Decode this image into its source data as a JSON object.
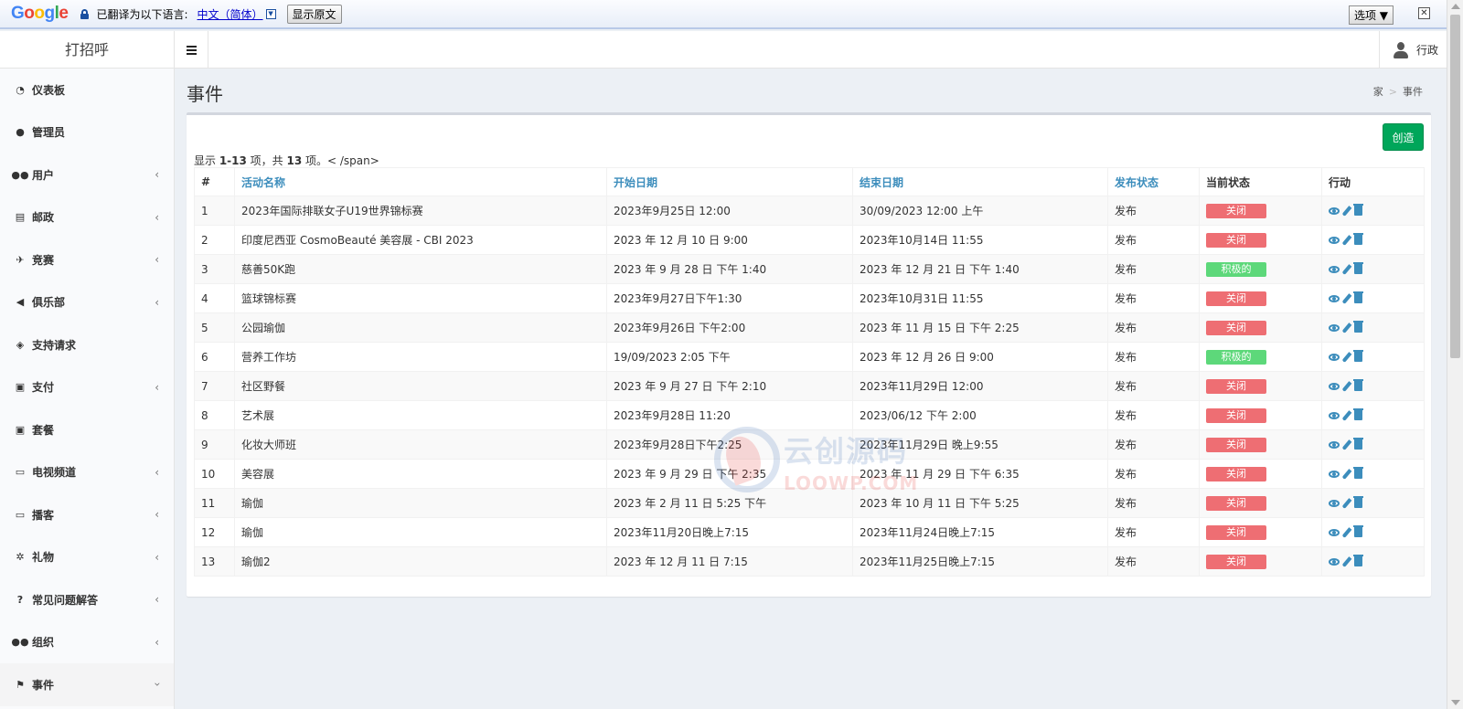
{
  "translate_bar": {
    "logo": "Google",
    "message": "已翻译为以下语言:",
    "language": "中文（简体）",
    "show_original": "显示原文",
    "options": "选项 ▼",
    "close": "✕"
  },
  "header": {
    "brand": "打招呼",
    "user_name": "行政"
  },
  "sidebar": {
    "items": [
      {
        "label": "仪表板",
        "icon": "dashboard-icon",
        "chevron": false
      },
      {
        "label": "管理员",
        "icon": "user-icon",
        "chevron": false
      },
      {
        "label": "用户",
        "icon": "users-icon",
        "chevron": true
      },
      {
        "label": "邮政",
        "icon": "newspaper-icon",
        "chevron": true
      },
      {
        "label": "竞赛",
        "icon": "runner-icon",
        "chevron": true
      },
      {
        "label": "俱乐部",
        "icon": "megaphone-icon",
        "chevron": true
      },
      {
        "label": "支持请求",
        "icon": "ticket-icon",
        "chevron": false
      },
      {
        "label": "支付",
        "icon": "money-icon",
        "chevron": true
      },
      {
        "label": "套餐",
        "icon": "money-icon",
        "chevron": false
      },
      {
        "label": "电视频道",
        "icon": "monitor-icon",
        "chevron": true
      },
      {
        "label": "播客",
        "icon": "monitor-icon",
        "chevron": true
      },
      {
        "label": "礼物",
        "icon": "gift-icon",
        "chevron": true
      },
      {
        "label": "常见问题解答",
        "icon": "question-icon",
        "chevron": true
      },
      {
        "label": "组织",
        "icon": "users-icon",
        "chevron": true
      },
      {
        "label": "事件",
        "icon": "flag-icon",
        "chevron": true,
        "active": true
      }
    ]
  },
  "page": {
    "title": "事件",
    "breadcrumb_home": "家",
    "breadcrumb_current": "事件",
    "create_label": "创造",
    "summary_prefix": "显示 ",
    "summary_range": "1-13",
    "summary_mid": " 项，共 ",
    "summary_total": "13",
    "summary_suffix": " 项。< /span>"
  },
  "table": {
    "headers": [
      "#",
      "活动名称",
      "开始日期",
      "结束日期",
      "发布状态",
      "当前状态",
      "行动"
    ],
    "rows": [
      {
        "num": "1",
        "name": "2023年国际排联女子U19世界锦标赛",
        "start": "2023年9月25日 12:00",
        "end": "30/09/2023 12:00 上午",
        "publish": "发布",
        "status": "关闭",
        "active": false
      },
      {
        "num": "2",
        "name": "印度尼西亚 CosmoBeauté 美容展 - CBI 2023",
        "start": "2023 年 12 月 10 日 9:00",
        "end": "2023年10月14日 11:55",
        "publish": "发布",
        "status": "关闭",
        "active": false
      },
      {
        "num": "3",
        "name": "慈善50K跑",
        "start": "2023 年 9 月 28 日 下午 1:40",
        "end": "2023 年 12 月 21 日 下午 1:40",
        "publish": "发布",
        "status": "积极的",
        "active": true
      },
      {
        "num": "4",
        "name": "篮球锦标赛",
        "start": "2023年9月27日下午1:30",
        "end": "2023年10月31日 11:55",
        "publish": "发布",
        "status": "关闭",
        "active": false
      },
      {
        "num": "5",
        "name": "公园瑜伽",
        "start": "2023年9月26日 下午2:00",
        "end": "2023 年 11 月 15 日 下午 2:25",
        "publish": "发布",
        "status": "关闭",
        "active": false
      },
      {
        "num": "6",
        "name": "营养工作坊",
        "start": "19/09/2023 2:05 下午",
        "end": "2023 年 12 月 26 日 9:00",
        "publish": "发布",
        "status": "积极的",
        "active": true
      },
      {
        "num": "7",
        "name": "社区野餐",
        "start": "2023 年 9 月 27 日 下午 2:10",
        "end": "2023年11月29日 12:00",
        "publish": "发布",
        "status": "关闭",
        "active": false
      },
      {
        "num": "8",
        "name": "艺术展",
        "start": "2023年9月28日 11:20",
        "end": "2023/06/12 下午 2:00",
        "publish": "发布",
        "status": "关闭",
        "active": false
      },
      {
        "num": "9",
        "name": "化妆大师班",
        "start": "2023年9月28日下午2:25",
        "end": "2023年11月29日 晚上9:55",
        "publish": "发布",
        "status": "关闭",
        "active": false
      },
      {
        "num": "10",
        "name": "美容展",
        "start": "2023 年 9 月 29 日 下午 2:35",
        "end": "2023 年 11 月 29 日 下午 6:35",
        "publish": "发布",
        "status": "关闭",
        "active": false
      },
      {
        "num": "11",
        "name": "瑜伽",
        "start": "2023 年 2 月 11 日 5:25 下午",
        "end": "2023 年 10 月 11 日 下午 5:25",
        "publish": "发布",
        "status": "关闭",
        "active": false
      },
      {
        "num": "12",
        "name": "瑜伽",
        "start": "2023年11月20日晚上7:15",
        "end": "2023年11月24日晚上7:15",
        "publish": "发布",
        "status": "关闭",
        "active": false
      },
      {
        "num": "13",
        "name": "瑜伽2",
        "start": "2023 年 12 月 11 日 7:15",
        "end": "2023年11月25日晚上7:15",
        "publish": "发布",
        "status": "关闭",
        "active": false
      }
    ]
  },
  "watermark": {
    "line1": "云创源码",
    "line2": "LOOWP.COM"
  },
  "colors": {
    "accent": "#3c8dbc",
    "create_button": "#00a65a",
    "status_closed": "#ee6e73",
    "status_active": "#5dd87a"
  }
}
